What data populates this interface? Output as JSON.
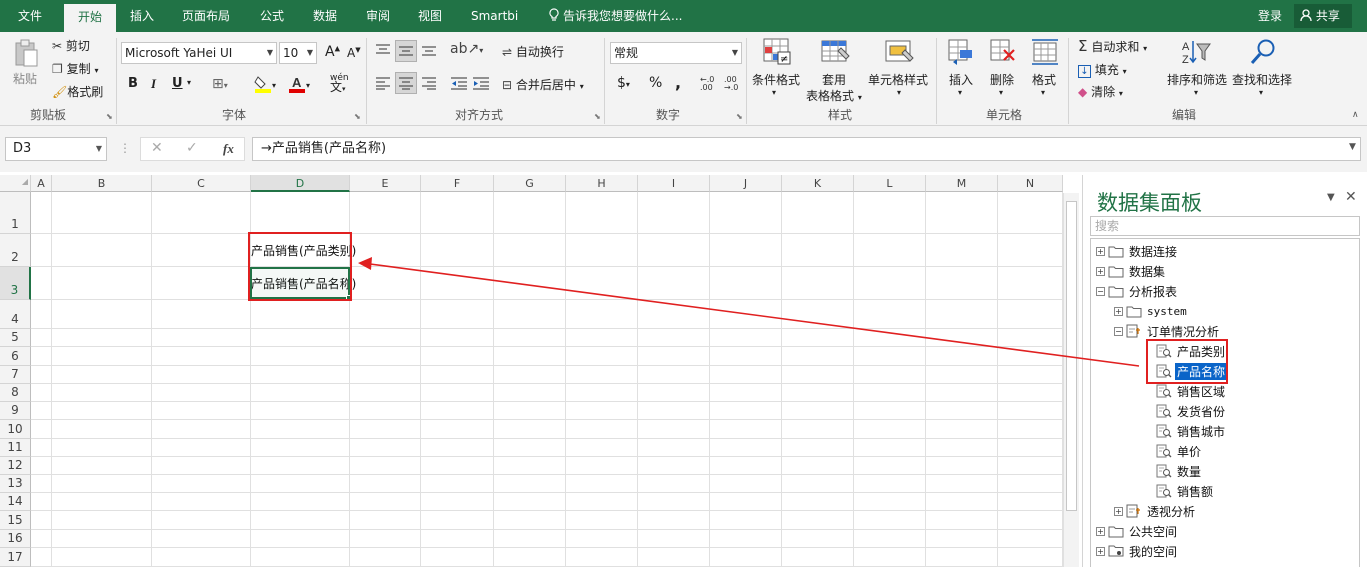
{
  "tabs": [
    "文件",
    "开始",
    "插入",
    "页面布局",
    "公式",
    "数据",
    "审阅",
    "视图",
    "Smartbi"
  ],
  "active_tab": "开始",
  "tell_me": "告诉我您想要做什么...",
  "login": "登录",
  "share": "共享",
  "clipboard": {
    "paste": "粘贴",
    "cut": "剪切",
    "copy": "复制",
    "format_painter": "格式刷",
    "label": "剪贴板"
  },
  "font": {
    "name": "Microsoft YaHei UI",
    "size": "10",
    "label": "字体",
    "bold": "B",
    "italic": "I",
    "underline": "U",
    "grow": "A",
    "shrink": "A",
    "phonetic": "wén"
  },
  "alignment": {
    "wrap": "自动换行",
    "merge": "合并后居中",
    "label": "对齐方式"
  },
  "number": {
    "format": "常规",
    "currency": "$",
    "percent": "%",
    "comma": ",",
    "label": "数字"
  },
  "styles": {
    "conditional": "条件格式",
    "table": "套用",
    "table2": "表格格式",
    "cell": "单元格样式",
    "label": "样式"
  },
  "cells": {
    "insert": "插入",
    "delete": "删除",
    "format": "格式",
    "label": "单元格"
  },
  "editing": {
    "autosum": "自动求和",
    "fill": "填充",
    "clear": "清除",
    "sort": "排序和筛选",
    "find": "查找和选择",
    "label": "编辑"
  },
  "namebox": "D3",
  "formula": "→产品销售(产品名称)",
  "columns": [
    "A",
    "B",
    "C",
    "D",
    "E",
    "F",
    "G",
    "H",
    "I",
    "J",
    "K",
    "L",
    "M",
    "N"
  ],
  "rows": [
    "1",
    "2",
    "3",
    "4",
    "5",
    "6",
    "7",
    "8",
    "9",
    "10",
    "11",
    "12",
    "13",
    "14",
    "15",
    "16",
    "17"
  ],
  "cells_content": {
    "d2": "产品销售(产品类别)",
    "d3": "产品销售(产品名称)"
  },
  "panel": {
    "title": "数据集面板",
    "search_placeholder": "搜索",
    "tree": {
      "data_connection": "数据连接",
      "dataset": "数据集",
      "analysis_report": "分析报表",
      "system": "system",
      "order_analysis": "订单情况分析",
      "product_category": "产品类别",
      "product_name": "产品名称",
      "sales_region": "销售区域",
      "ship_province": "发货省份",
      "sales_city": "销售城市",
      "unit_price": "单价",
      "quantity": "数量",
      "sales_amount": "销售额",
      "pivot_analysis": "透视分析",
      "public_space": "公共空间",
      "my_space": "我的空间"
    }
  },
  "colors": {
    "excel_green": "#217346",
    "highlight_red": "#e02020",
    "selection_blue": "#0a64c8"
  }
}
